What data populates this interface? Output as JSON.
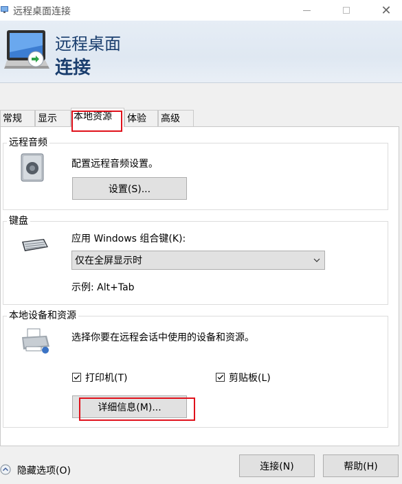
{
  "window": {
    "title": "远程桌面连接"
  },
  "header": {
    "line1": "远程桌面",
    "line2": "连接"
  },
  "tabs": [
    {
      "label": "常规"
    },
    {
      "label": "显示"
    },
    {
      "label": "本地资源"
    },
    {
      "label": "体验"
    },
    {
      "label": "高级"
    }
  ],
  "remote_audio": {
    "title": "远程音频",
    "description": "配置远程音频设置。",
    "settings_button": "设置(S)..."
  },
  "keyboard": {
    "title": "键盘",
    "apply_label": "应用 Windows 组合键(K):",
    "selected_option": "仅在全屏显示时",
    "example": "示例: Alt+Tab"
  },
  "local_devices": {
    "title": "本地设备和资源",
    "description": "选择你要在远程会话中使用的设备和资源。",
    "printer_label": "打印机(T)",
    "printer_checked": true,
    "clipboard_label": "剪贴板(L)",
    "clipboard_checked": true,
    "details_button": "详细信息(M)..."
  },
  "footer": {
    "hide_options": "隐藏选项(O)",
    "connect_button": "连接(N)",
    "help_button": "帮助(H)"
  },
  "colors": {
    "highlight": "#e0101a",
    "header_text": "#1a3e6e"
  }
}
